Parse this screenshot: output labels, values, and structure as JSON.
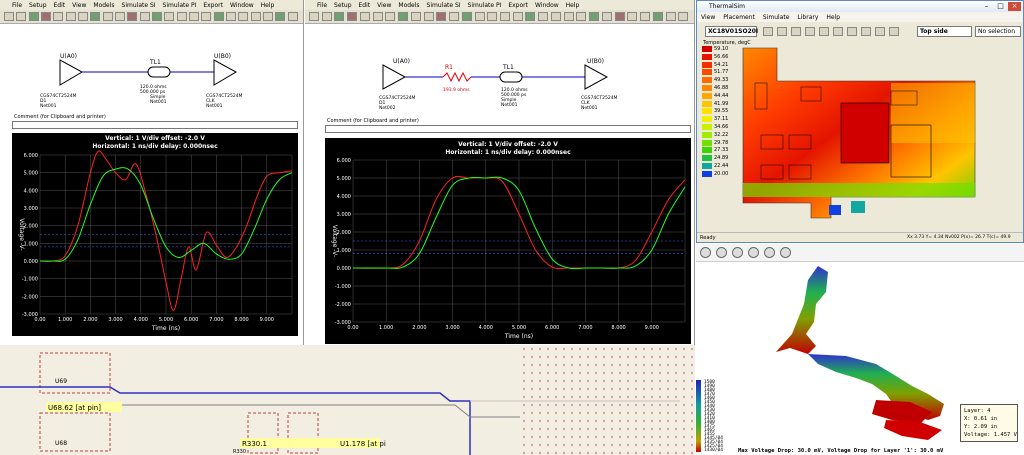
{
  "left_window": {
    "menu": [
      "File",
      "Setup",
      "Edit",
      "View",
      "Models",
      "Simulate SI",
      "Simulate PI",
      "Export",
      "Window",
      "Help"
    ],
    "schematic": {
      "driver": "U(A0)",
      "driver_part": "CGS74CT2524M",
      "driver_pin": "D1",
      "driver_net": "Net001",
      "tline": "TL1",
      "tline_params": "120.0 ohms\n500.000 ps\nSimple\nNet001",
      "receiver": "U(B0)",
      "receiver_part": "CGS74CT2524M",
      "receiver_pin": "CLK",
      "receiver_net": "Net001"
    },
    "comment_label": "Comment (for Clipboard and printer)",
    "scope": {
      "vertical": "Vertical: 1  V/div  offset: -2.0 V",
      "horizontal": "Horizontal: 1  ns/div  delay: 0.000nsec",
      "ylabel": "Voltage -V-",
      "xlabel": "Time (ns)"
    }
  },
  "middle_window": {
    "menu": [
      "File",
      "Setup",
      "Edit",
      "View",
      "Models",
      "Simulate SI",
      "Simulate PI",
      "Export",
      "Window",
      "Help"
    ],
    "schematic": {
      "driver": "U(A0)",
      "driver_part": "CGS74CT2524M",
      "driver_pin": "D1",
      "driver_net": "Net002",
      "resistor": "R1",
      "resistor_value": "193.9 ohms",
      "tline": "TL1",
      "tline_params": "120.0 ohms\n500.000 ps\nSimple\nNet001",
      "receiver": "U(B0)",
      "receiver_part": "CGS74CT2524M",
      "receiver_pin": "CLK",
      "receiver_net": "Net001"
    },
    "comment_label": "Comment (for Clipboard and printer)",
    "scope": {
      "vertical": "Vertical: 1  V/div  offset: -2.0 V",
      "horizontal": "Horizontal: 1  ns/div  delay: 0.000nsec",
      "ylabel": "Voltage -V-",
      "xlabel": "Time (ns)"
    }
  },
  "chart_data": [
    {
      "type": "line",
      "title": "",
      "xlabel": "Time (ns)",
      "ylabel": "Voltage -V-",
      "xlim": [
        0,
        10
      ],
      "ylim": [
        -3,
        6
      ],
      "x_ticks": [
        "0.00",
        "1.000",
        "2.000",
        "3.000",
        "4.000",
        "5.000",
        "6.000",
        "7.000",
        "8.000",
        "9.000"
      ],
      "y_ticks": [
        "6.000",
        "5.000",
        "4.000",
        "3.000",
        "2.000",
        "1.000",
        "0.000",
        "-1.000",
        "-2.000",
        "-3.000"
      ],
      "series": [
        {
          "color": "#ff2020",
          "x": [
            0,
            0.5,
            1,
            1.5,
            2,
            2.3,
            2.6,
            3,
            3.4,
            3.8,
            4.2,
            4.6,
            5,
            5.3,
            5.6,
            5.9,
            6.2,
            6.6,
            7,
            7.4,
            7.8,
            8.2,
            8.6,
            9,
            9.5,
            10
          ],
          "y": [
            0,
            0,
            0.3,
            2,
            5,
            6.2,
            5.8,
            5.0,
            4.6,
            5.5,
            3.8,
            1.5,
            -1.2,
            -2.8,
            -1.0,
            0.8,
            -0.5,
            1.6,
            0.9,
            0.2,
            0.8,
            2.0,
            3.6,
            4.8,
            5.0,
            5.1
          ]
        },
        {
          "color": "#20ff20",
          "x": [
            0,
            0.5,
            1,
            1.5,
            2,
            2.5,
            3,
            3.5,
            4,
            4.5,
            5,
            5.5,
            6,
            6.5,
            7,
            7.5,
            8,
            8.5,
            9,
            9.5,
            10
          ],
          "y": [
            0,
            0,
            0.1,
            1.2,
            3.2,
            4.8,
            5.2,
            5.2,
            4.3,
            2.4,
            0.8,
            0.2,
            0.6,
            1.0,
            0.4,
            0.1,
            0.4,
            1.8,
            3.5,
            4.6,
            5.0
          ]
        }
      ]
    },
    {
      "type": "line",
      "title": "",
      "xlabel": "Time (ns)",
      "ylabel": "Voltage -V-",
      "xlim": [
        0,
        10
      ],
      "ylim": [
        -3,
        6
      ],
      "x_ticks": [
        "0.00",
        "1.000",
        "2.000",
        "3.000",
        "4.000",
        "5.000",
        "6.000",
        "7.000",
        "8.000",
        "9.000"
      ],
      "y_ticks": [
        "6.000",
        "5.000",
        "4.000",
        "3.000",
        "2.000",
        "1.000",
        "0.000",
        "-1.000",
        "-2.000",
        "-3.000"
      ],
      "series": [
        {
          "color": "#ff2020",
          "x": [
            0,
            1,
            1.5,
            2,
            2.5,
            3,
            3.5,
            4,
            4.5,
            5,
            5.5,
            6,
            6.5,
            7,
            7.5,
            8,
            8.5,
            9,
            9.5,
            10
          ],
          "y": [
            0,
            0,
            0.2,
            1.5,
            3.8,
            5.0,
            5.0,
            5.0,
            4.8,
            3.0,
            1.0,
            0.05,
            0,
            0,
            0,
            0,
            0.4,
            2.0,
            3.8,
            4.9
          ]
        },
        {
          "color": "#20ff20",
          "x": [
            0,
            1,
            1.5,
            2,
            2.5,
            3,
            3.5,
            4,
            4.5,
            5,
            5.5,
            6,
            6.5,
            7,
            7.5,
            8,
            8.5,
            9,
            9.5,
            10
          ],
          "y": [
            0,
            0,
            0.05,
            0.8,
            2.8,
            4.6,
            5.0,
            5.0,
            5.0,
            4.3,
            2.2,
            0.5,
            0,
            0,
            0,
            0,
            0.1,
            1.0,
            3.0,
            4.5
          ]
        }
      ]
    }
  ],
  "pcb": {
    "labels": [
      "U69",
      "U68.62 [at pin]",
      "U68",
      "R330",
      "R330.1",
      "U1.178 [at pi"
    ]
  },
  "thermal": {
    "title": "ThermalSim",
    "menu": [
      "View",
      "Placement",
      "Simulate",
      "Library",
      "Help"
    ],
    "part_combo": "XC18V01SO20I",
    "side_combo": "Top side",
    "selection_combo": "No selection",
    "legend_title": "Temperature, degC",
    "legend": [
      {
        "label": "59.10",
        "color": "#d00000"
      },
      {
        "label": "56.66",
        "color": "#e41400"
      },
      {
        "label": "54.21",
        "color": "#f03000"
      },
      {
        "label": "51.77",
        "color": "#f84c00"
      },
      {
        "label": "49.33",
        "color": "#ff6a00"
      },
      {
        "label": "46.88",
        "color": "#ff8800"
      },
      {
        "label": "44.44",
        "color": "#ffa600"
      },
      {
        "label": "41.99",
        "color": "#ffc400"
      },
      {
        "label": "39.55",
        "color": "#ffe000"
      },
      {
        "label": "37.11",
        "color": "#eef000"
      },
      {
        "label": "34.66",
        "color": "#c8f000"
      },
      {
        "label": "32.22",
        "color": "#a0ec00"
      },
      {
        "label": "29.78",
        "color": "#70e000"
      },
      {
        "label": "27.33",
        "color": "#40d400"
      },
      {
        "label": "24.89",
        "color": "#20c040"
      },
      {
        "label": "22.44",
        "color": "#10a8a0"
      },
      {
        "label": "20.00",
        "color": "#1040e0"
      }
    ],
    "status_left": "Ready",
    "status_right": "Xx   3.73  Y=    4.34  Nv002  P(x)=  26.7  T(c)=  49.9"
  },
  "voltage": {
    "scale": [
      "1500",
      "1490",
      "1480",
      "1470",
      "1460",
      "1450",
      "1440",
      "1430",
      "1420",
      "1410",
      "1400",
      "1475",
      "1465",
      "1455",
      "1445/04",
      "1435/04",
      "1425/04",
      "1430/04"
    ],
    "info": [
      "Layer: 4",
      "X: 0.61 in",
      "Y: 2.09 in",
      "Voltage: 1.457 V"
    ],
    "caption": "Max Voltage Drop: 30.0 mV, Voltage Drop for Layer '1': 30.0 mV"
  }
}
